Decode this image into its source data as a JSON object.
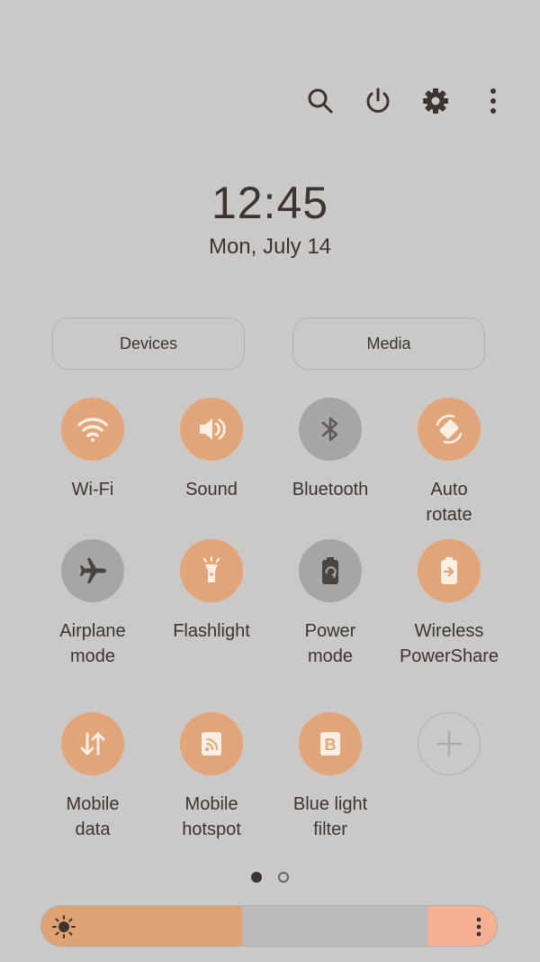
{
  "status": {
    "time": "12:45",
    "date": "Mon, July 14"
  },
  "topbar": {
    "icons": [
      "search-icon",
      "power-icon",
      "settings-icon",
      "more-options-icon"
    ]
  },
  "panels": {
    "devices_label": "Devices",
    "media_label": "Media"
  },
  "tiles": [
    {
      "label": "Wi-Fi",
      "icon": "wifi-icon",
      "state": "on"
    },
    {
      "label": "Sound",
      "icon": "sound-icon",
      "state": "on"
    },
    {
      "label": "Bluetooth",
      "icon": "bluetooth-icon",
      "state": "off"
    },
    {
      "label": "Auto rotate",
      "icon": "auto-rotate-icon",
      "state": "on"
    },
    {
      "label": "Airplane mode",
      "icon": "airplane-icon",
      "state": "off"
    },
    {
      "label": "Flashlight",
      "icon": "flashlight-icon",
      "state": "on"
    },
    {
      "label": "Power mode",
      "icon": "power-mode-icon",
      "state": "off"
    },
    {
      "label": "Wireless PowerShare",
      "icon": "wireless-powershare-icon",
      "state": "on"
    },
    {
      "label": "Mobile data",
      "icon": "mobile-data-icon",
      "state": "on"
    },
    {
      "label": "Mobile hotspot",
      "icon": "mobile-hotspot-icon",
      "state": "on"
    },
    {
      "label": "Blue light filter",
      "icon": "blue-light-filter-icon",
      "state": "on"
    },
    {
      "label": "",
      "icon": "add-tile-icon",
      "state": "add"
    }
  ],
  "pagination": {
    "pages": 2,
    "current": 1
  },
  "brightness": {
    "level": 0.44,
    "icon": "sun-icon",
    "menu_icon": "more-options-icon"
  },
  "colors": {
    "background": "#cbc9c7",
    "accent_on": "#e2a57a",
    "tile_off": "#a8a6a4",
    "text": "#3d3330",
    "brightness_fill": "#dfa373",
    "brightness_end": "#f6b192"
  }
}
